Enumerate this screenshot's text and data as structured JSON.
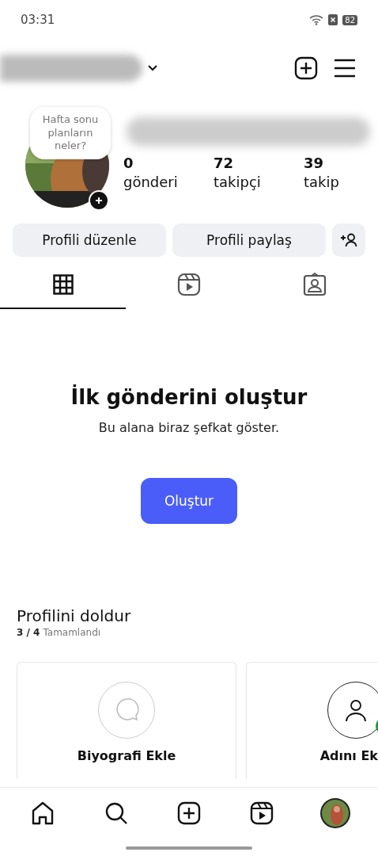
{
  "status_bar": {
    "time": "03:31",
    "battery": "82"
  },
  "story_note": {
    "text": "Hafta sonu planların neler?"
  },
  "stats": [
    {
      "value": "0",
      "label": "gönderi"
    },
    {
      "value": "72",
      "label": "takipçi"
    },
    {
      "value": "39",
      "label": "takip"
    }
  ],
  "buttons": [
    "Profili düzenle",
    "Profili paylaş"
  ],
  "tabs": [
    {
      "kind": "grid",
      "selected": true
    },
    {
      "kind": "reels",
      "selected": false
    },
    {
      "kind": "tagged",
      "selected": false
    }
  ],
  "empty_state": {
    "title": "İlk gönderini oluştur",
    "subtitle": "Bu alana biraz şefkat göster.",
    "button": "Oluştur"
  },
  "complete_profile": {
    "title": "Profilini doldur",
    "progress": "3 / 4",
    "progress_label": "Tamamlandı",
    "cards": [
      {
        "kind": "bio",
        "title": "Biyografi Ekle",
        "done": false
      },
      {
        "kind": "name",
        "title": "Adını Ek",
        "done": true
      }
    ]
  },
  "bottom_nav": [
    {
      "kind": "home"
    },
    {
      "kind": "search"
    },
    {
      "kind": "create"
    },
    {
      "kind": "reels"
    },
    {
      "kind": "profile"
    }
  ]
}
